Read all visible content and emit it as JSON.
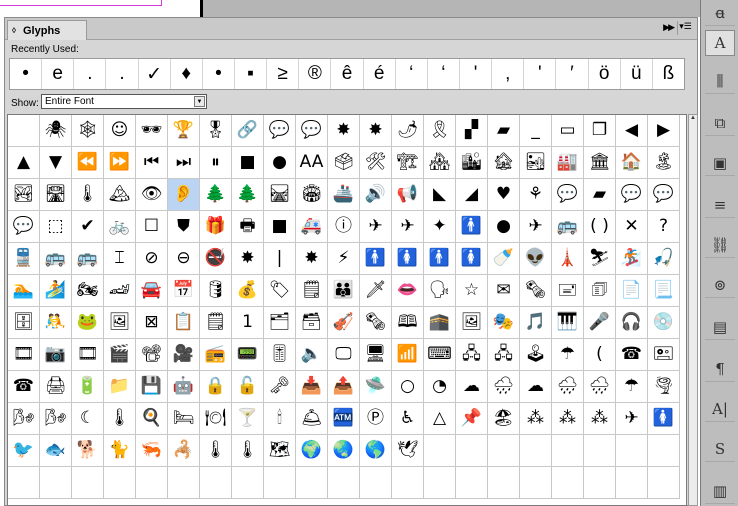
{
  "panel": {
    "title": "Glyphs",
    "recent_label": "Recently Used:",
    "show_label": "Show:",
    "show_value": "Entire Font",
    "expand_icon": "double-chevron-right-icon",
    "menu_icon": "panel-menu-icon"
  },
  "recently_used": [
    "•",
    "e",
    ".",
    ".",
    "✓",
    "♦",
    "•",
    "▪",
    "≥",
    "®",
    "ê",
    "é",
    "‘",
    "‘",
    "'",
    "‚",
    "'",
    "′",
    "ö",
    "ü",
    "ß"
  ],
  "glyph_rows": [
    [
      "",
      "🕷",
      "🕸",
      "☺",
      "🕶",
      "🏆",
      "🎖",
      "🔗",
      "💬",
      "💬",
      "✸",
      "✸",
      "🌶",
      "🎗",
      "▞",
      "▰",
      "_",
      "▭",
      "❐",
      "◀",
      "▶"
    ],
    [
      "▲",
      "▼",
      "⏪",
      "⏩",
      "⏮",
      "⏭",
      "⏸",
      "■",
      "●",
      "AA",
      "🗳",
      "🛠",
      "🏗",
      "🏘",
      "🏙",
      "🏚",
      "🏜",
      "🏭",
      "🏛",
      "🏠",
      "🏝"
    ],
    [
      "🏞",
      "🛣",
      "🌡",
      "🏔",
      "👁",
      "👂",
      "🌲",
      "🌲",
      "🛤",
      "🏟",
      "🚢",
      "🔊",
      "📢",
      "◣",
      "◢",
      "♥",
      "⚘",
      "💬",
      "▰",
      "💬",
      "💬"
    ],
    [
      "💬",
      "⬚",
      "✔",
      "🚲",
      "☐",
      "⛊",
      "🎁",
      "🖶",
      "■",
      "🚑",
      "ⓘ",
      "✈",
      "✈",
      "✦",
      "🚹",
      "●",
      "✈",
      "🚌",
      "( )",
      "✕",
      "?"
    ],
    [
      "🚆",
      "🚌",
      "🚌",
      "⌶",
      "⊘",
      "⊖",
      "🚭",
      "✸",
      "|",
      "✸",
      "⚡",
      "🚹",
      "🚺",
      "🚹",
      "🚺",
      "🍼",
      "👽",
      "🗼",
      "⛷",
      "🏂",
      "🎣"
    ],
    [
      "🏊",
      "🏄",
      "🏍",
      "🏎",
      "🚘",
      "📅",
      "🛢",
      "💰",
      "🏷",
      "🗒",
      "👪",
      "🗡",
      "👄",
      "🗣",
      "☆",
      "✉",
      "🗞",
      "🖃",
      "🗊",
      "📄",
      "📃"
    ],
    [
      "🗄",
      "🤼",
      "🐸",
      "🖼",
      "⊠",
      "📋",
      "🗒",
      "1",
      "🗂",
      "🗃",
      "🎻",
      "🗞",
      "🕮",
      "🕋",
      "🖼",
      "🎭",
      "🎵",
      "🎹",
      "🎤",
      "🎧",
      "💿"
    ],
    [
      "🎞",
      "📷",
      "🎞",
      "🎬",
      "📽",
      "🎥",
      "📻",
      "📟",
      "🎚",
      "🔈",
      "🖵",
      "🖥",
      "📶",
      "⌨",
      "🖧",
      "🖧",
      "🕹",
      "☂",
      "(",
      "☎",
      "🖭"
    ],
    [
      "☎",
      "🖨",
      "🔋",
      "📁",
      "💾",
      "🤖",
      "🔒",
      "🔓",
      "🗝",
      "📥",
      "📤",
      "🛸",
      "○",
      "◔",
      "☁",
      "🌧",
      "☁",
      "🌧",
      "🌧",
      "☂",
      "🌪"
    ],
    [
      "🌬",
      "🌬",
      "☾",
      "🌡",
      "🍳",
      "🛏",
      "🍽",
      "🍸",
      "🕯",
      "🛎",
      "🏧",
      "Ⓟ",
      "♿",
      "△",
      "📌",
      "🏖",
      "⁂",
      "⁂",
      "⁂",
      "✈",
      "🚺"
    ],
    [
      "🐦",
      "🐟",
      "🐕",
      "🐈",
      "🦐",
      "🦂",
      "🌡",
      "🌡",
      "🗺",
      "🌍",
      "🌏",
      "🌎",
      "🕊",
      "",
      "",
      "",
      "",
      "",
      "",
      "",
      ""
    ],
    [
      "",
      "",
      "",
      "",
      "",
      "",
      "",
      "",
      "",
      "",
      "",
      "",
      "",
      "",
      "",
      "",
      "",
      "",
      "",
      "",
      ""
    ]
  ],
  "tools": [
    {
      "name": "character-styles-icon",
      "glyph": "ꬰ"
    },
    {
      "name": "character-icon",
      "glyph": "A"
    },
    {
      "name": "align-icon",
      "glyph": "⫼"
    },
    {
      "name": "pathfinder-icon",
      "glyph": "⧉"
    },
    {
      "name": "stroke-icon",
      "glyph": "▣"
    },
    {
      "name": "lines-icon",
      "glyph": "≡"
    },
    {
      "name": "links-icon",
      "glyph": "⛓"
    },
    {
      "name": "effects-icon",
      "glyph": "⊚"
    },
    {
      "name": "gradient-icon",
      "glyph": "▤"
    },
    {
      "name": "paragraph-icon",
      "glyph": "¶"
    },
    {
      "name": "text-wrap-icon",
      "glyph": "A|"
    },
    {
      "name": "object-styles-icon",
      "glyph": "S"
    },
    {
      "name": "library-icon",
      "glyph": "▥"
    }
  ],
  "colors": {
    "selection": "#bcd4f3",
    "panel_bg": "#d6d6d6",
    "dock_bg": "#bdbdbd"
  }
}
